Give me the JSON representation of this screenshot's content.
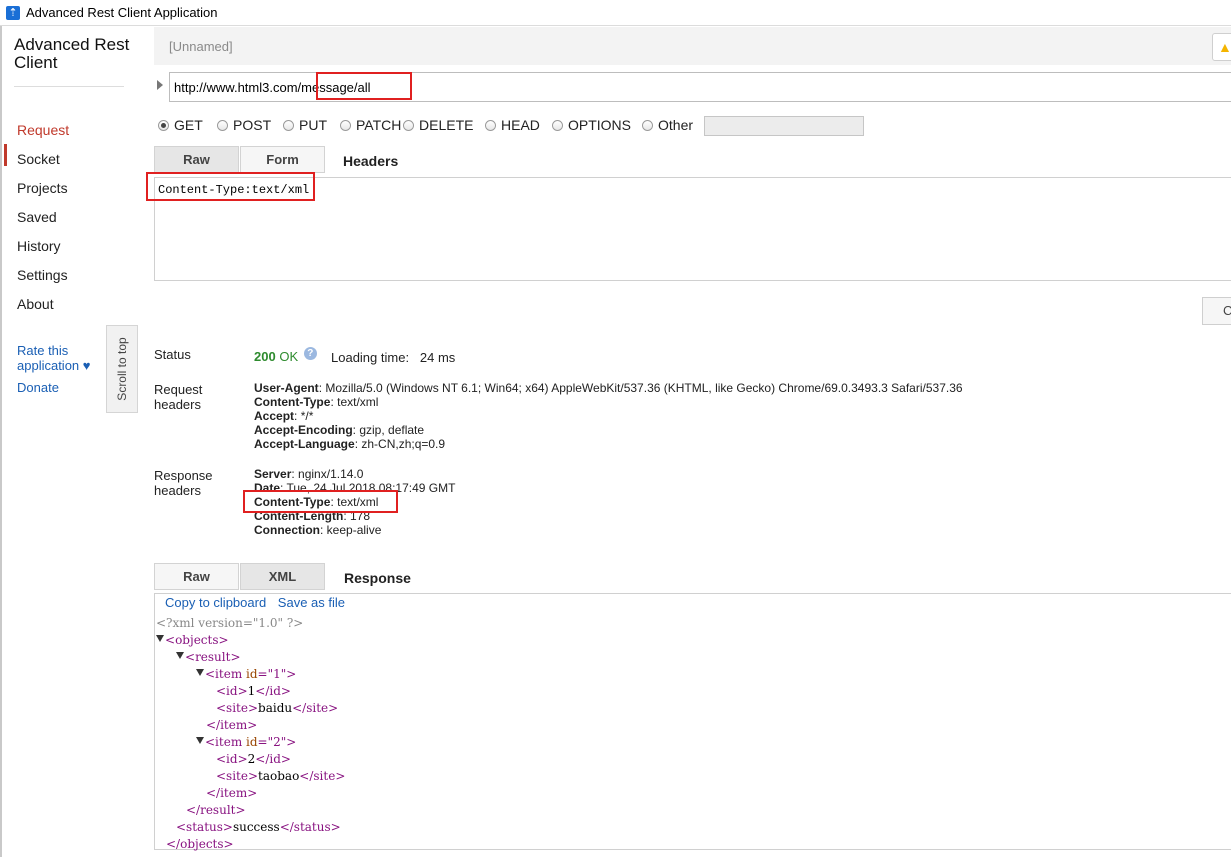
{
  "window": {
    "title": "Advanced Rest Client Application"
  },
  "sidebar": {
    "brand": "Advanced Rest Client",
    "items": [
      {
        "label": "Request",
        "active": true
      },
      {
        "label": "Socket"
      },
      {
        "label": "Projects"
      },
      {
        "label": "Saved"
      },
      {
        "label": "History"
      },
      {
        "label": "Settings"
      },
      {
        "label": "About"
      }
    ],
    "rate": "Rate this application ♥",
    "donate": "Donate",
    "scroll_top": "Scroll to top"
  },
  "request": {
    "name": "[Unnamed]",
    "url": "http://www.html3.com/message/all",
    "methods": [
      {
        "label": "GET",
        "selected": true
      },
      {
        "label": "POST"
      },
      {
        "label": "PUT"
      },
      {
        "label": "PATCH"
      },
      {
        "label": "DELETE"
      },
      {
        "label": "HEAD"
      },
      {
        "label": "OPTIONS"
      },
      {
        "label": "Other"
      }
    ],
    "tabs": {
      "raw": "Raw",
      "form": "Form",
      "heading": "Headers"
    },
    "headers_text": "Content-Type:text/xml",
    "send_label": "C"
  },
  "response": {
    "status_label": "Status",
    "status_code": "200",
    "status_text": "OK",
    "loading_label": "Loading time:",
    "loading_value": "24 ms",
    "request_headers_label": "Request headers",
    "request_headers": [
      {
        "name": "User-Agent",
        "value": "Mozilla/5.0 (Windows NT 6.1; Win64; x64) AppleWebKit/537.36 (KHTML, like Gecko) Chrome/69.0.3493.3 Safari/537.36"
      },
      {
        "name": "Content-Type",
        "value": "text/xml"
      },
      {
        "name": "Accept",
        "value": "*/*"
      },
      {
        "name": "Accept-Encoding",
        "value": "gzip, deflate"
      },
      {
        "name": "Accept-Language",
        "value": "zh-CN,zh;q=0.9"
      }
    ],
    "response_headers_label": "Response headers",
    "response_headers": [
      {
        "name": "Server",
        "value": "nginx/1.14.0"
      },
      {
        "name": "Date",
        "value": "Tue, 24 Jul 2018 08:17:49 GMT"
      },
      {
        "name": "Content-Type",
        "value": "text/xml"
      },
      {
        "name": "Content-Length",
        "value": "178"
      },
      {
        "name": "Connection",
        "value": "keep-alive"
      }
    ],
    "tabs": {
      "raw": "Raw",
      "xml": "XML",
      "heading": "Response"
    },
    "actions": {
      "copy": "Copy to clipboard",
      "save": "Save as file"
    },
    "xml": {
      "declaration": "<?xml version=\"1.0\" ?>",
      "root": "objects",
      "result": "result",
      "items": [
        {
          "id_attr": "1",
          "id": "1",
          "site": "baidu"
        },
        {
          "id_attr": "2",
          "id": "2",
          "site": "taobao"
        }
      ],
      "status": "success"
    }
  }
}
